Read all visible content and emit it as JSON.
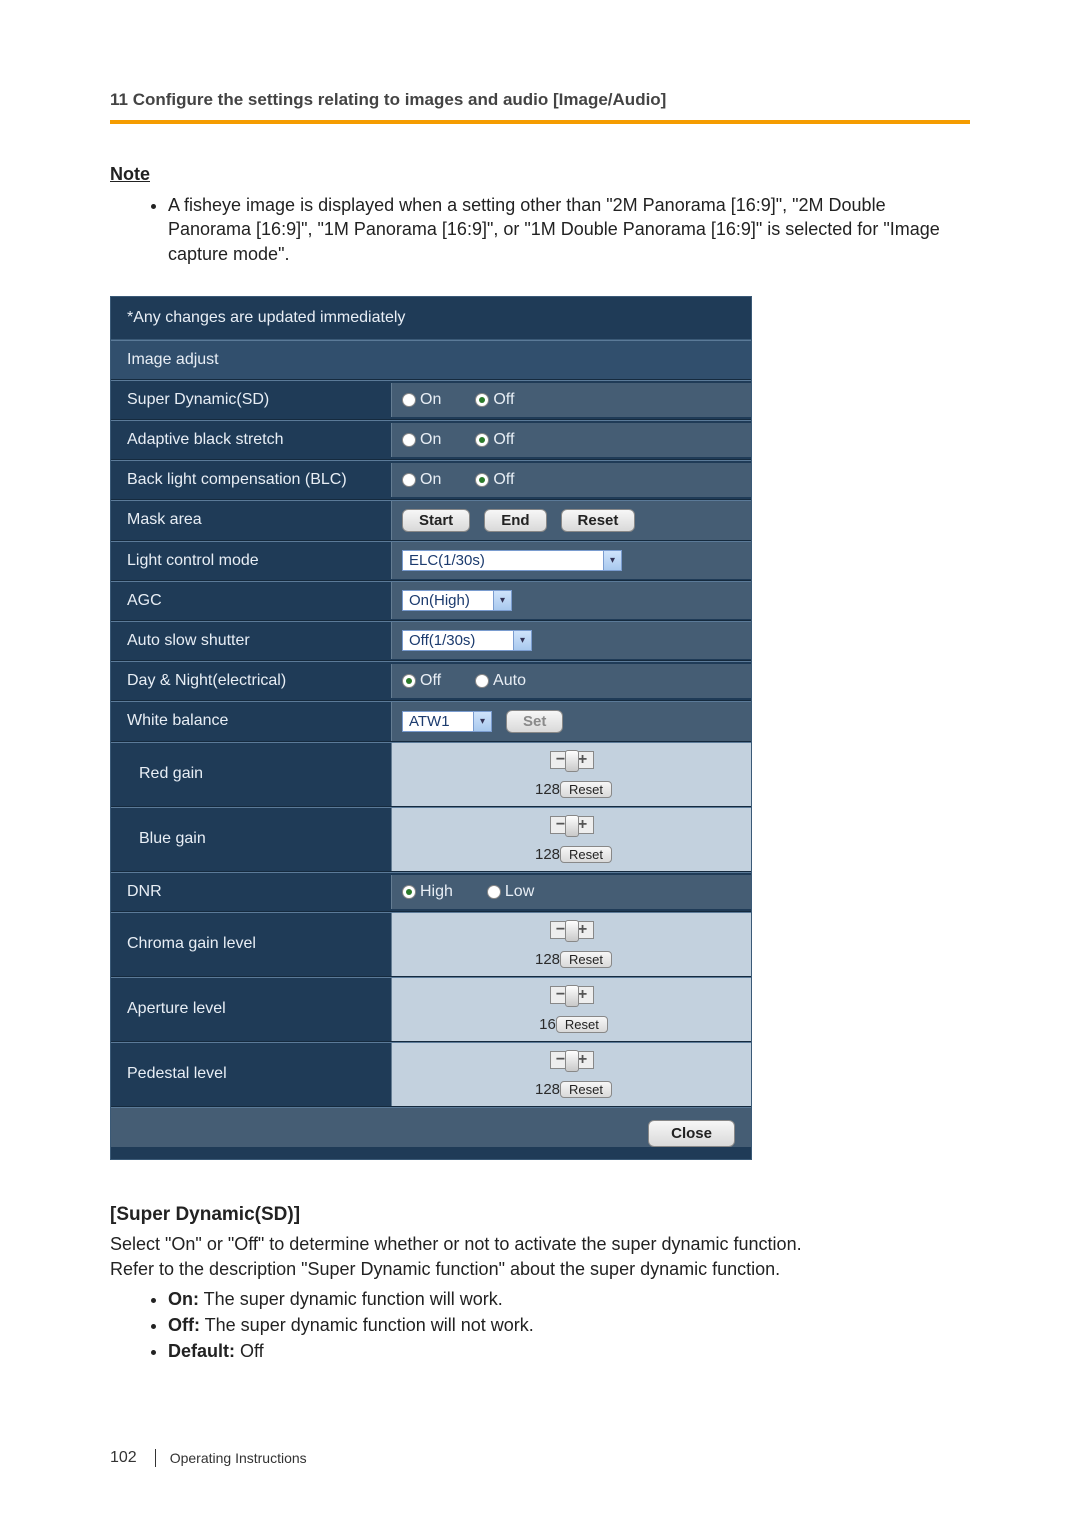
{
  "header": "11 Configure the settings relating to images and audio [Image/Audio]",
  "note": {
    "label": "Note",
    "text": "A fisheye image is displayed when a setting other than \"2M Panorama [16:9]\", \"2M Double Panorama [16:9]\", \"1M Panorama [16:9]\", or \"1M Double Panorama [16:9]\" is selected for \"Image capture mode\"."
  },
  "panel": {
    "notice": "*Any changes are updated immediately",
    "section_title": "Image adjust",
    "rows": {
      "sd": {
        "label": "Super Dynamic(SD)",
        "on": "On",
        "off": "Off",
        "selected": "off"
      },
      "abs": {
        "label": "Adaptive black stretch",
        "on": "On",
        "off": "Off",
        "selected": "off"
      },
      "blc": {
        "label": "Back light compensation (BLC)",
        "on": "On",
        "off": "Off",
        "selected": "off"
      },
      "mask": {
        "label": "Mask area",
        "start": "Start",
        "end": "End",
        "reset": "Reset"
      },
      "lcm": {
        "label": "Light control mode",
        "value": "ELC(1/30s)"
      },
      "agc": {
        "label": "AGC",
        "value": "On(High)"
      },
      "ass": {
        "label": "Auto slow shutter",
        "value": "Off(1/30s)"
      },
      "dn": {
        "label": "Day & Night(electrical)",
        "off": "Off",
        "auto": "Auto",
        "selected": "off"
      },
      "wb": {
        "label": "White balance",
        "value": "ATW1",
        "set": "Set"
      },
      "red": {
        "label": "Red gain",
        "value": "128",
        "reset": "Reset",
        "pos": 50
      },
      "blue": {
        "label": "Blue gain",
        "value": "128",
        "reset": "Reset",
        "pos": 50
      },
      "dnr": {
        "label": "DNR",
        "high": "High",
        "low": "Low",
        "selected": "high"
      },
      "chroma": {
        "label": "Chroma gain level",
        "value": "128",
        "reset": "Reset",
        "pos": 50
      },
      "apert": {
        "label": "Aperture level",
        "value": "16",
        "reset": "Reset",
        "pos": 50
      },
      "ped": {
        "label": "Pedestal level",
        "value": "128",
        "reset": "Reset",
        "pos": 50
      }
    },
    "close": "Close"
  },
  "section": {
    "heading": "[Super Dynamic(SD)]",
    "p1": "Select \"On\" or \"Off\" to determine whether or not to activate the super dynamic function.",
    "p2": "Refer to the description \"Super Dynamic function\" about the super dynamic function.",
    "opts": {
      "on_b": "On:",
      "on_t": " The super dynamic function will work.",
      "off_b": "Off:",
      "off_t": " The super dynamic function will not work.",
      "def_b": "Default:",
      "def_t": " Off"
    }
  },
  "footer": {
    "page": "102",
    "text": "Operating Instructions"
  }
}
